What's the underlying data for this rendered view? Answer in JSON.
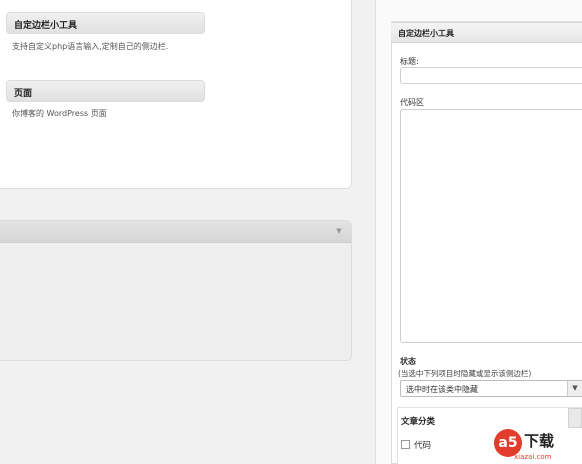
{
  "available_widgets": [
    {
      "title": "自定边栏小工具",
      "description": "支持自定义php语言输入,定制自己的侧边栏."
    },
    {
      "title": "页面",
      "description": "你博客的 WordPress 页面"
    }
  ],
  "sidebar": {
    "widget_title": "自定边栏小工具",
    "title_label": "标题:",
    "title_value": "",
    "code_label": "代码区",
    "code_value": "",
    "logic_label": "状态",
    "logic_hint": "(当选中下列项目时隐藏或显示该侧边栏)",
    "logic_selected": "选中时在该类中隐藏",
    "category_title": "文章分类",
    "categories": [
      {
        "label": "代码",
        "checked": false
      }
    ]
  },
  "watermark": {
    "logo_char": "a5",
    "text": "下载",
    "domain": "xiazai.com"
  },
  "icons": {
    "collapse_arrow": "▼",
    "select_arrow": "▼"
  }
}
